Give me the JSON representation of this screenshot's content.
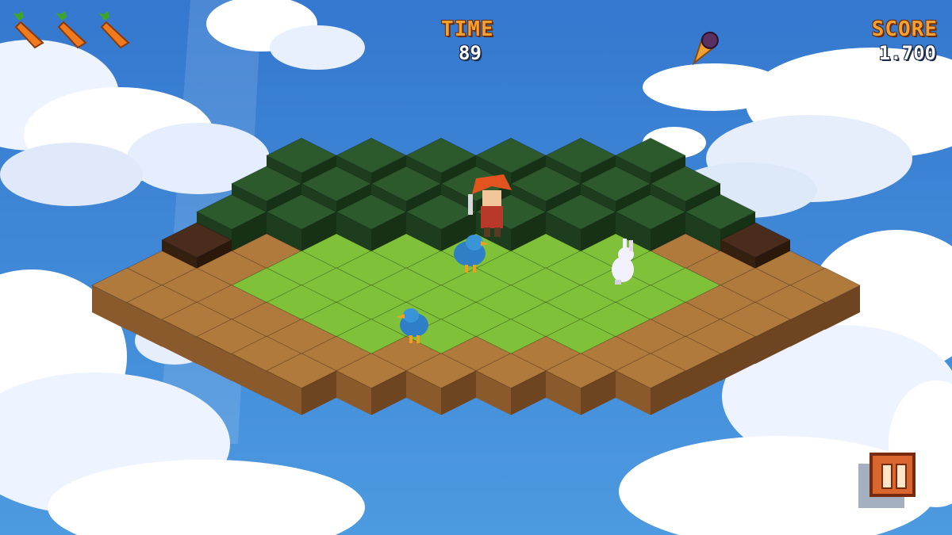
{
  "hud": {
    "time_label": "TIME",
    "time_value": "89",
    "score_label": "SCORE",
    "score_value": "1.700",
    "lives": 3,
    "life_icon": "carrot-icon",
    "pause_icon": "pause-icon",
    "powerup_icon": "ice-cream-cone-icon"
  },
  "colors": {
    "sky": "#3f8ad8",
    "grass_top": "#7fc23a",
    "dirt_top": "#b07a3c",
    "forest_top": "#2d5a2d",
    "hud_label": "#f5a030",
    "pause_button": "#d9652f"
  }
}
